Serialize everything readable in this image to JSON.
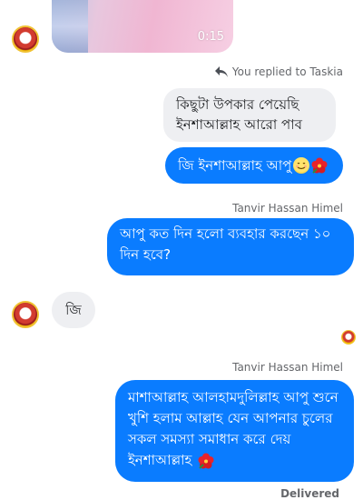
{
  "video": {
    "duration": "0:15"
  },
  "reply_header": {
    "text": "You replied to Taskia"
  },
  "quoted_message": {
    "text": "কিছুটা উপকার পেয়েছি ইনশাআল্লাহ আরো পাব"
  },
  "messages": [
    {
      "sender": "",
      "text": "জি ইনশাআল্লাহ আপু",
      "emoji": [
        "smiling-face-icon",
        "hibiscus-icon"
      ],
      "side": "right"
    },
    {
      "sender": "Tanvir Hassan Himel",
      "text": "আপু কত দিন হলো ব্যবহার করছেন ১০ দিন হবে?",
      "side": "right"
    },
    {
      "sender": "",
      "text": "জি",
      "side": "left"
    },
    {
      "sender": "Tanvir Hassan Himel",
      "text": "মাশাআল্লাহ আলহামদুলিল্লাহ আপু শুনে খুশি হলাম আল্লাহ যেন আপনার চুলের সকল সমস্যা সমাধান করে দেয় ইনশাআল্লাহ",
      "emoji": [
        "hibiscus-icon"
      ],
      "side": "right"
    }
  ],
  "status": {
    "delivered": "Delivered"
  },
  "colors": {
    "outgoing_bubble": "#0a7cff",
    "incoming_bubble": "#eeeff2",
    "meta_text": "#65676b"
  }
}
